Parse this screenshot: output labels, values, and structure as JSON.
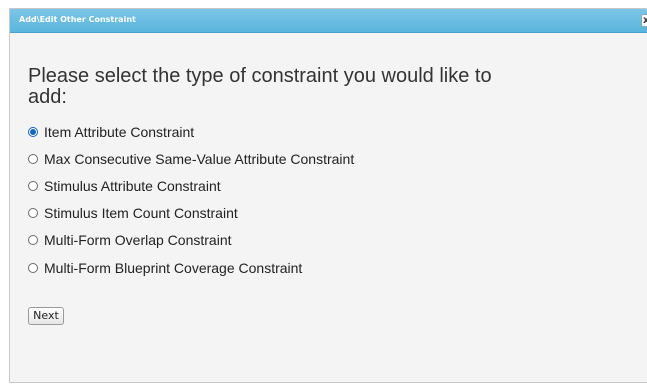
{
  "dialog": {
    "title": "Add\\Edit Other Constraint",
    "close_glyph": "x"
  },
  "prompt": "Please select the type of constraint you would like to add:",
  "options": [
    {
      "label": "Item Attribute Constraint",
      "selected": true
    },
    {
      "label": "Max Consecutive Same-Value Attribute Constraint",
      "selected": false
    },
    {
      "label": "Stimulus Attribute Constraint",
      "selected": false
    },
    {
      "label": "Stimulus Item Count Constraint",
      "selected": false
    },
    {
      "label": "Multi-Form Overlap Constraint",
      "selected": false
    },
    {
      "label": "Multi-Form Blueprint Coverage Constraint",
      "selected": false
    }
  ],
  "actions": {
    "next_label": "Next"
  },
  "colors": {
    "titlebar": "#5bb5dd",
    "radio_selected": "#1565c0",
    "dialog_background": "#f4f4f4"
  },
  "icons": {
    "close": "close-icon"
  }
}
